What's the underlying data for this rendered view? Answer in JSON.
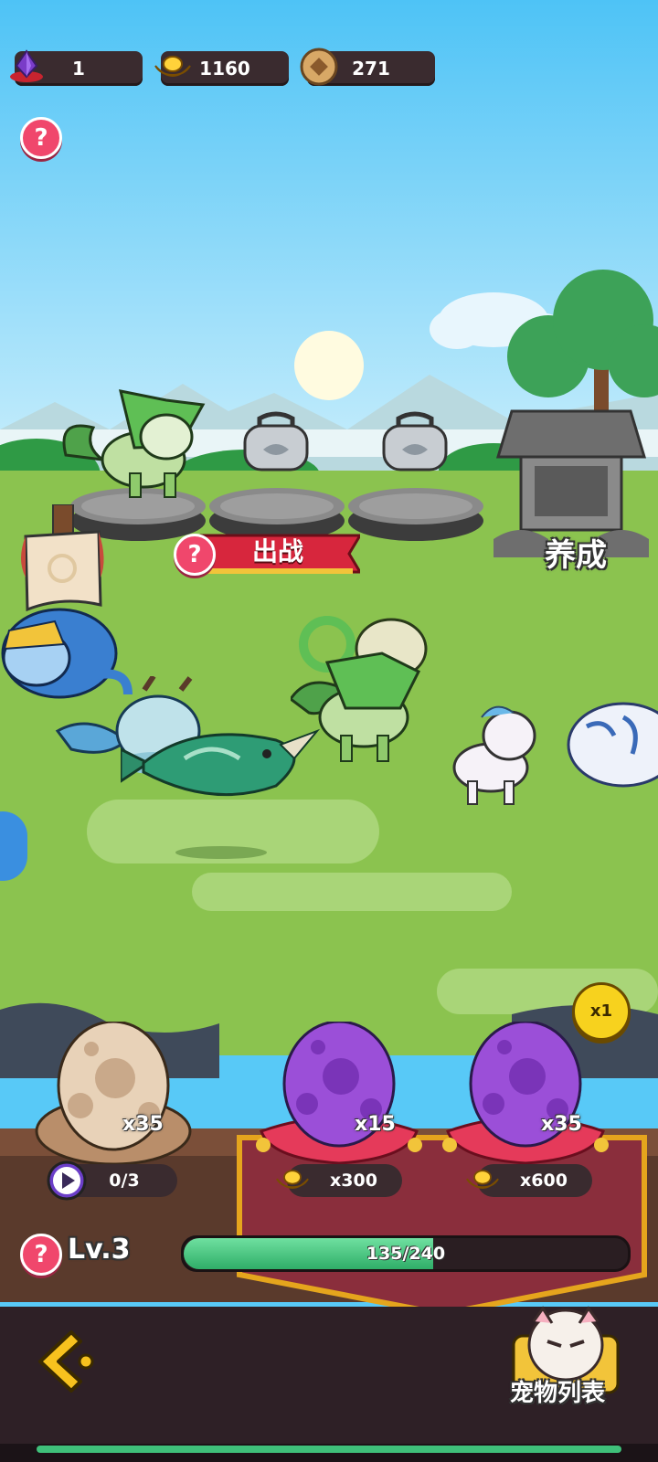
{
  "resources": {
    "crystal": {
      "value": "1",
      "icon": "purple-crystal-icon"
    },
    "gold": {
      "value": "1160",
      "icon": "gold-ingot-icon"
    },
    "coin": {
      "value": "271",
      "icon": "copper-coin-icon"
    }
  },
  "battle": {
    "banner_label": "出战"
  },
  "nurture": {
    "label": "养成"
  },
  "hatch": {
    "multiplier": "x1",
    "eggs": [
      {
        "type": "common",
        "count": "x35",
        "progress": "0/3"
      },
      {
        "type": "purple",
        "count": "x15",
        "price": "x300"
      },
      {
        "type": "purple",
        "count": "x35",
        "price": "x600"
      }
    ]
  },
  "level": {
    "label": "Lv.3",
    "xp_text": "135/240",
    "xp_current": 135,
    "xp_max": 240
  },
  "nav": {
    "pet_list_label": "宠物列表"
  },
  "colors": {
    "sky": "#58c9f7",
    "grass": "#8bc34f",
    "panel": "#3a2b2f",
    "accent_red": "#d7263d",
    "xp_green": "#3fc07a"
  }
}
